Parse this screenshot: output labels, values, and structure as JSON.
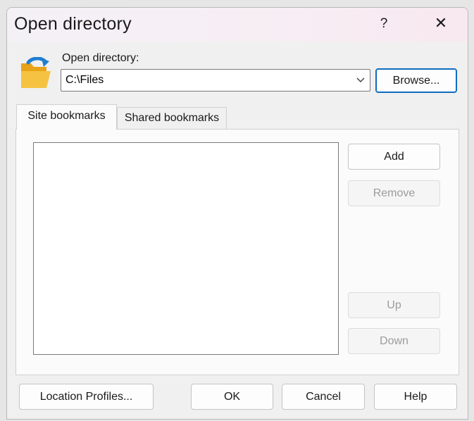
{
  "window": {
    "title": "Open directory",
    "help_glyph": "?",
    "close_glyph": "✕"
  },
  "directory": {
    "label": "Open directory:",
    "value": "C:\\Files",
    "browse_label": "Browse..."
  },
  "tabs": [
    {
      "label": "Site bookmarks",
      "active": true
    },
    {
      "label": "Shared bookmarks",
      "active": false
    }
  ],
  "bookmarks": {
    "items": [],
    "buttons": {
      "add": "Add",
      "remove": "Remove",
      "up": "Up",
      "down": "Down"
    }
  },
  "footer": {
    "location_profiles": "Location Profiles...",
    "ok": "OK",
    "cancel": "Cancel",
    "help": "Help"
  },
  "colors": {
    "focus_accent": "#0f6cbd",
    "folder_yellow": "#f5b82e",
    "folder_arrow": "#1e7fd1"
  },
  "icons": {
    "folder": "open-folder-icon",
    "dropdown": "chevron-down-icon",
    "close": "close-icon",
    "help": "help-icon"
  }
}
